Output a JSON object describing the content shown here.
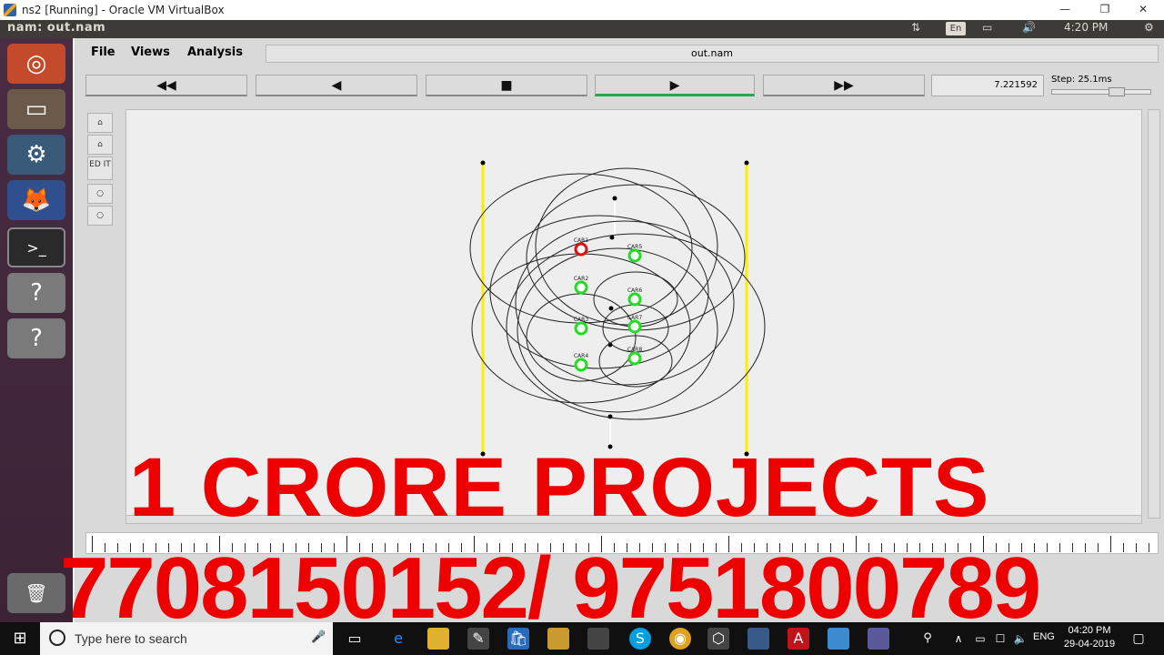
{
  "vbox": {
    "title": "ns2 [Running] - Oracle VM VirtualBox",
    "minimize": "—",
    "restore": "❐",
    "close": "✕"
  },
  "ubuntu_panel": {
    "window_title": "nam: out.nam",
    "lang": "En",
    "volume_icon": "🔊",
    "time": "4:20 PM",
    "settings_icon": "⚙"
  },
  "launcher": [
    {
      "name": "ubuntu-dash-icon",
      "glyph": "◎",
      "color": "#e0603a"
    },
    {
      "name": "files-icon",
      "glyph": "▭",
      "color": "#d9d1c4"
    },
    {
      "name": "settings-icon",
      "glyph": "⚙",
      "color": "#8b9aa6"
    },
    {
      "name": "firefox-icon",
      "glyph": "🦊",
      "color": "#e8742a"
    },
    {
      "name": "terminal-icon",
      "glyph": ">_",
      "color": "#2a2a2a"
    },
    {
      "name": "unknown-app-icon",
      "glyph": "?",
      "color": "#9a9a9a"
    },
    {
      "name": "unknown-app-icon",
      "glyph": "?",
      "color": "#9a9a9a"
    }
  ],
  "nam": {
    "menus": [
      "File",
      "Views",
      "Analysis"
    ],
    "file_title": "out.nam",
    "controls": {
      "fast_rewind": "◀◀",
      "rewind": "◀",
      "stop": "■",
      "play": "▶",
      "fast_forward": "▶▶"
    },
    "time": "7.221592",
    "step_label": "Step: 25.1ms",
    "tools": [
      "⌂",
      "⌂",
      "ED IT",
      "○",
      "○"
    ]
  },
  "topology": {
    "node_labels": [
      "CAR1",
      "CAR2",
      "CAR3",
      "CAR4",
      "CAR5",
      "CAR6",
      "CAR7",
      "CAR8"
    ]
  },
  "watermark": {
    "title": "1 CRORE PROJECTS",
    "phones": "7708150152/ 9751800789"
  },
  "taskbar": {
    "search_placeholder": "Type here to search",
    "time": "04:20 PM",
    "date": "29-04-2019",
    "lang": "ENG"
  }
}
